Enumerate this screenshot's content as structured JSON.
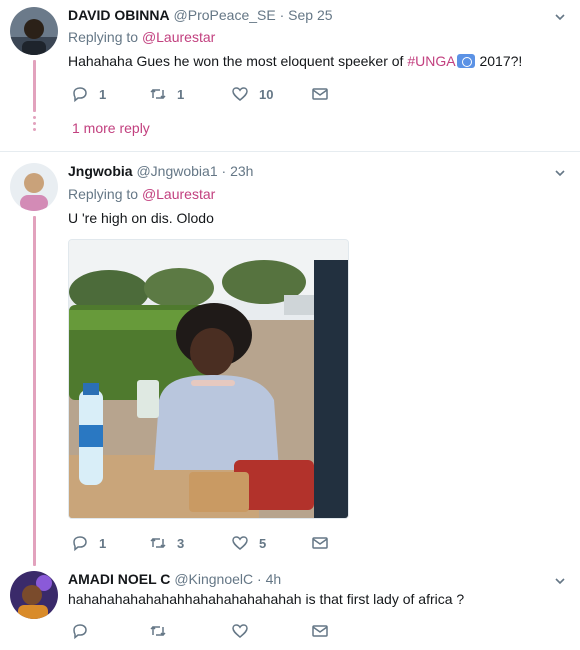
{
  "tweets": [
    {
      "name": "DAVID OBINNA",
      "handle": "@ProPeace_SE",
      "separator": "·",
      "time": "Sep 25",
      "replying_prefix": "Replying to",
      "replying_to": "@Laurestar",
      "text_before": "Hahahaha Gues he won the most eloquent speeker of ",
      "hashtag": "#UNGA",
      "text_after": " 2017?!",
      "replies": "1",
      "retweets": "1",
      "likes": "10",
      "more_reply": "1 more reply"
    },
    {
      "name": "Jngwobia",
      "handle": "@Jngwobia1",
      "separator": "·",
      "time": "23h",
      "replying_prefix": "Replying to",
      "replying_to": "@Laurestar",
      "text": "U 're high on dis. Olodo",
      "replies": "1",
      "retweets": "3",
      "likes": "5"
    },
    {
      "name": "AMADI NOEL C",
      "handle": "@KingnoelC",
      "separator": "·",
      "time": "4h",
      "text": "hahahahahahahahhahahahahahahah is that first lady of africa ?"
    }
  ],
  "icons": {
    "reply": "reply-icon",
    "retweet": "retweet-icon",
    "like": "heart-icon",
    "dm": "envelope-icon",
    "caret": "chevron-down-icon",
    "emoji": "un-flag-emoji-icon"
  },
  "colors": {
    "accent": "#c2407f",
    "thread_line": "#e2a2bd",
    "muted": "#657786",
    "divider": "#e6ecf0"
  }
}
